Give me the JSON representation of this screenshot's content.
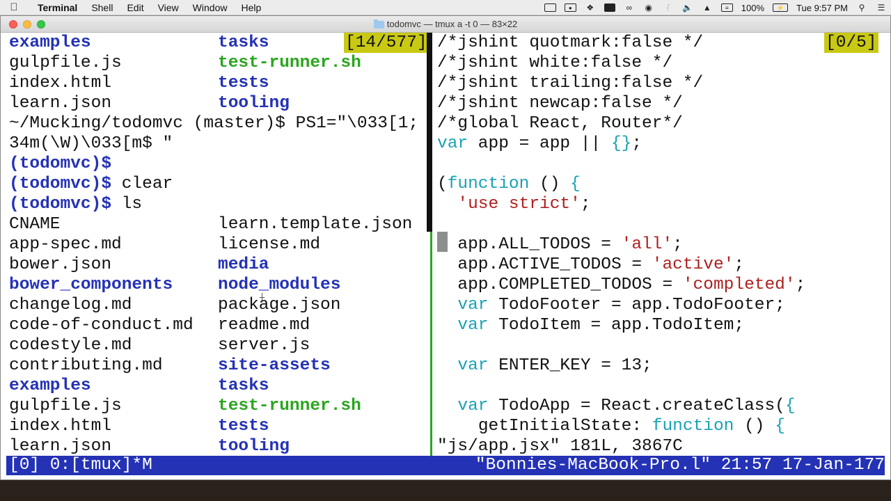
{
  "menubar": {
    "apple_icon": "apple-icon",
    "items": [
      "Terminal",
      "Shell",
      "Edit",
      "View",
      "Window",
      "Help"
    ],
    "battery": "100%",
    "clock": "Tue 9:57 PM"
  },
  "window": {
    "title": "todomvc — tmux a -t 0 — 83×22"
  },
  "left_pane": {
    "lines": [
      {
        "c1": "examples",
        "c1_style": "blue",
        "c2": "tasks",
        "c2_style": "blue"
      },
      {
        "c1": "gulpfile.js",
        "c1_style": "plain",
        "c2": "test-runner.sh",
        "c2_style": "green"
      },
      {
        "c1": "index.html",
        "c1_style": "plain",
        "c2": "tests",
        "c2_style": "blue"
      },
      {
        "c1": "learn.json",
        "c1_style": "plain",
        "c2": "tooling",
        "c2_style": "blue"
      }
    ],
    "counter": "[14/577]",
    "prompt_cmd": "~/Mucking/todomvc (master)$ PS1=\"\\033[1;",
    "prompt_cmd_cont": "34m(\\W)\\033[m$ \"",
    "prompt": "(todomvc)$",
    "cmd_clear": "clear",
    "cmd_ls": "ls",
    "listing": [
      {
        "c1": "CNAME",
        "c1_style": "plain",
        "c2": "learn.template.json",
        "c2_style": "plain"
      },
      {
        "c1": "app-spec.md",
        "c1_style": "plain",
        "c2": "license.md",
        "c2_style": "plain"
      },
      {
        "c1": "bower.json",
        "c1_style": "plain",
        "c2": "media",
        "c2_style": "blue"
      },
      {
        "c1": "bower_components",
        "c1_style": "blue",
        "c2": "node_modules",
        "c2_style": "blue"
      },
      {
        "c1": "changelog.md",
        "c1_style": "plain",
        "c2": "package.json",
        "c2_style": "plain"
      },
      {
        "c1": "code-of-conduct.md",
        "c1_style": "plain",
        "c2": "readme.md",
        "c2_style": "plain"
      },
      {
        "c1": "codestyle.md",
        "c1_style": "plain",
        "c2": "server.js",
        "c2_style": "plain"
      },
      {
        "c1": "contributing.md",
        "c1_style": "plain",
        "c2": "site-assets",
        "c2_style": "blue"
      },
      {
        "c1": "examples",
        "c1_style": "blue",
        "c2": "tasks",
        "c2_style": "blue"
      },
      {
        "c1": "gulpfile.js",
        "c1_style": "plain",
        "c2": "test-runner.sh",
        "c2_style": "green"
      },
      {
        "c1": "index.html",
        "c1_style": "plain",
        "c2": "tests",
        "c2_style": "blue"
      },
      {
        "c1": "learn.json",
        "c1_style": "plain",
        "c2": "tooling",
        "c2_style": "blue"
      }
    ]
  },
  "right_pane": {
    "counter": "[0/5]",
    "code": [
      {
        "indent": "",
        "parts": [
          {
            "t": "/*jshint quotmark:false */",
            "s": "plain"
          }
        ]
      },
      {
        "indent": "",
        "parts": [
          {
            "t": "/*jshint white:false */",
            "s": "plain"
          }
        ]
      },
      {
        "indent": "",
        "parts": [
          {
            "t": "/*jshint trailing:false */",
            "s": "plain"
          }
        ]
      },
      {
        "indent": "",
        "parts": [
          {
            "t": "/*jshint newcap:false */",
            "s": "plain"
          }
        ]
      },
      {
        "indent": "",
        "parts": [
          {
            "t": "/*global React, Router*/",
            "s": "plain"
          }
        ]
      },
      {
        "indent": "",
        "parts": [
          {
            "t": "var",
            "s": "kw"
          },
          {
            "t": " app = app || ",
            "s": "plain"
          },
          {
            "t": "{}",
            "s": "brace"
          },
          {
            "t": ";",
            "s": "plain"
          }
        ]
      },
      {
        "indent": "",
        "parts": []
      },
      {
        "indent": "",
        "parts": [
          {
            "t": "(",
            "s": "plain"
          },
          {
            "t": "function",
            "s": "kw"
          },
          {
            "t": " () ",
            "s": "plain"
          },
          {
            "t": "{",
            "s": "brace"
          }
        ]
      },
      {
        "indent": "  ",
        "parts": [
          {
            "t": "'use strict'",
            "s": "str"
          },
          {
            "t": ";",
            "s": "plain"
          }
        ]
      },
      {
        "indent": "",
        "parts": []
      },
      {
        "indent": "  ",
        "parts": [
          {
            "t": "app.ALL_TODOS = ",
            "s": "plain"
          },
          {
            "t": "'all'",
            "s": "str"
          },
          {
            "t": ";",
            "s": "plain"
          }
        ]
      },
      {
        "indent": "  ",
        "parts": [
          {
            "t": "app.ACTIVE_TODOS = ",
            "s": "plain"
          },
          {
            "t": "'active'",
            "s": "str"
          },
          {
            "t": ";",
            "s": "plain"
          }
        ]
      },
      {
        "indent": "  ",
        "parts": [
          {
            "t": "app.COMPLETED_TODOS = ",
            "s": "plain"
          },
          {
            "t": "'completed'",
            "s": "str"
          },
          {
            "t": ";",
            "s": "plain"
          }
        ]
      },
      {
        "indent": "  ",
        "parts": [
          {
            "t": "var",
            "s": "kw"
          },
          {
            "t": " TodoFooter = app.TodoFooter;",
            "s": "plain"
          }
        ]
      },
      {
        "indent": "  ",
        "parts": [
          {
            "t": "var",
            "s": "kw"
          },
          {
            "t": " TodoItem = app.TodoItem;",
            "s": "plain"
          }
        ]
      },
      {
        "indent": "",
        "parts": []
      },
      {
        "indent": "  ",
        "parts": [
          {
            "t": "var",
            "s": "kw"
          },
          {
            "t": " ENTER_KEY = 13;",
            "s": "plain"
          }
        ]
      },
      {
        "indent": "",
        "parts": []
      },
      {
        "indent": "  ",
        "parts": [
          {
            "t": "var",
            "s": "kw"
          },
          {
            "t": " TodoApp = React.createClass(",
            "s": "plain"
          },
          {
            "t": "{",
            "s": "brace"
          }
        ]
      },
      {
        "indent": "    ",
        "parts": [
          {
            "t": "getInitialState: ",
            "s": "plain"
          },
          {
            "t": "function",
            "s": "kw"
          },
          {
            "t": " () ",
            "s": "plain"
          },
          {
            "t": "{",
            "s": "brace"
          }
        ]
      }
    ],
    "file_status": "\"js/app.jsx\" 181L, 3867C"
  },
  "statusbar": {
    "left": "[0] 0:[tmux]*M",
    "right": "\"Bonnies-MacBook-Pro.l\" 21:57 17-Jan-177"
  },
  "colors": {
    "dir": "#2432b5",
    "exec": "#2aa61e",
    "keyword": "#19a2b5",
    "string": "#b02020",
    "status_bg": "#2432b5",
    "counter_bg": "#c9c914"
  }
}
